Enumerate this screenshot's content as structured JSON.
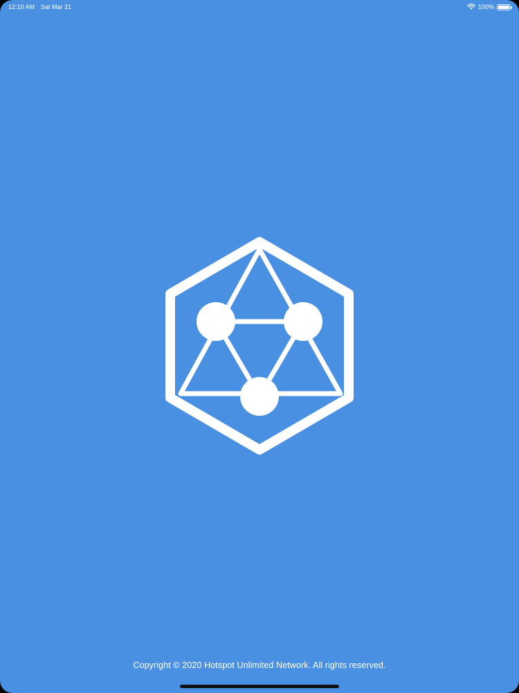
{
  "status_bar": {
    "time": "12:10 AM",
    "date": "Sat Mar 21",
    "battery_percent": "100%",
    "battery_level": 1.0,
    "icons": [
      "wifi-icon",
      "battery-icon"
    ]
  },
  "splash": {
    "logo_icon": "hexagon-network-logo",
    "background_color": "#4a90e2",
    "foreground_color": "#ffffff"
  },
  "footer": {
    "copyright": "Copyright © 2020 Hotspot Unlimited Network. All rights reserved."
  }
}
